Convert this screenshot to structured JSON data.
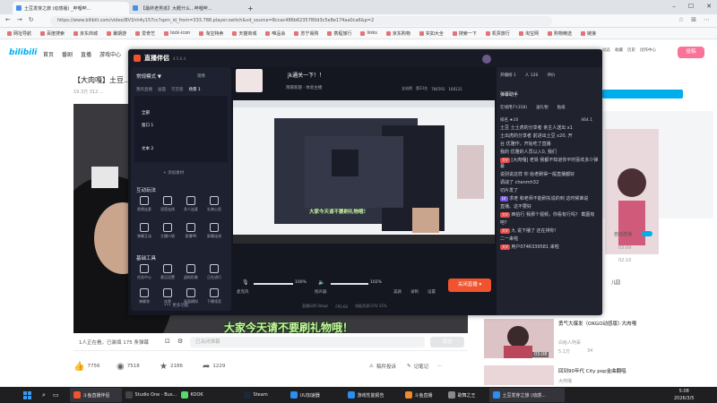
{
  "browser": {
    "tabs": [
      {
        "label": "土豆发芽之旅 (动感版) _哔哩哔..."
      },
      {
        "label": "【最终老男孩】大概什么...哔哩哔..."
      }
    ],
    "new_tab": "+",
    "url": "https://www.bilibili.com/video/BV1hh4y157cc?spm_id_from=333.788.player.switch&vd_source=8ccac486b6235780d3c5e8e174aa0ca6&p=2",
    "bookmarks": [
      "网址导航",
      "百度搜索",
      "京东商城",
      "暑期游",
      "爱奇艺",
      "lock-icon",
      "淘宝特卖",
      "天猫商城",
      "唯品会",
      "苏宁易购",
      "携程旅行",
      "links",
      "京东购物",
      "实如大全",
      "搜索一下",
      "机票旅行",
      "淘宝网",
      "购物精选",
      "链接"
    ]
  },
  "bilibili": {
    "logo": "bilibili",
    "nav": [
      "首页",
      "番剧",
      "直播",
      "游戏中心"
    ],
    "right_nav": [
      "大会员",
      "消息",
      "动态",
      "收藏",
      "历史",
      "创作中心"
    ],
    "upload_btn": "投稿",
    "title": "【大肉嘎】土豆...",
    "meta": "19.3万  312  ...",
    "subtitle": "大家今天请不要刷礼物哦！",
    "watch_count": "1人正在看，已装填 175 条弹幕",
    "danmaku_placeholder": "已关闭弹幕",
    "send": "发送",
    "likes": "7756",
    "coins": "7518",
    "favs": "2186",
    "shares": "1229",
    "report": "稿件投诉",
    "notes": "记笔记",
    "side": {
      "rec1_title": "勇气大爆发（OKGO动感版）·大肉嘎",
      "rec1_author": "白给人阿呆",
      "rec1_views": "5.1万",
      "rec1_danmaku": "34",
      "rec1_duration": "03:08",
      "rec2_title": "回到90年代 City pop金曲翻唱",
      "rec2_author": "大肉嘎",
      "times": [
        "03:09",
        "02:10"
      ],
      "label_auto": "自动连播",
      "child": "儿园"
    }
  },
  "app": {
    "name": "直播伴侣",
    "version": "4.5.6.4",
    "mode": "常规模式 ▼",
    "tabs": [
      "镜像",
      "横屏"
    ],
    "scene_tabs": [
      "我的直播",
      "画面",
      "可见窗",
      "场景 1",
      "+"
    ],
    "sources": [
      "全部",
      "窗口 1",
      "文本 2"
    ],
    "add_source": "+ 添加素材",
    "room_title": "jk通关一下！！",
    "room_sub": "简牒新题 · 体验主播",
    "stats": [
      "全站榜",
      "第23名",
      "784593",
      "168131"
    ],
    "interact_title": "互动玩法",
    "interact": [
      [
        "视频连麦",
        "语音连线",
        "多人连麦",
        "礼物心愿"
      ],
      [
        "弹幕互动",
        "主播口袋",
        "直播PK",
        "屏幕连线"
      ]
    ],
    "tools_title": "基础工具",
    "tools": [
      [
        "任务中心",
        "意见设置",
        "虚拟形象",
        "正在进行"
      ],
      [
        "弹幕答",
        "连登",
        "画面模拟",
        "下播领奖"
      ]
    ],
    "more": "••• 更多功能",
    "preview_overlay": "大家今天请不要刷礼物哦！",
    "preview_caption": "9:16比例直播上面置",
    "mic_label": "麦克风",
    "mic_vol": "100%",
    "spk_label": "扬声器",
    "spk_vol": "102%",
    "status": [
      "直播码率:0kbps",
      "FPS:60",
      "电脑资源:CPU 35%"
    ],
    "ctrl": [
      "美颜",
      "录制",
      "设置"
    ],
    "start": "关闭直播 ▾",
    "right_top": [
      "开播帮助",
      "分享",
      "设置"
    ],
    "right_head": [
      "开播榜 1",
      "人 120",
      "评价"
    ],
    "chat_assistant": "弹幕助手",
    "online_tabs": [
      "在线用户(358)",
      "送礼物",
      "贴纸"
    ],
    "rank": [
      "排名 ★10",
      "464.1"
    ],
    "chat": [
      {
        "name": "土豆",
        "text": "土土虎的分享者 亲主人送出 x1"
      },
      {
        "name": "",
        "text": "土出虎的分享者 前进出土豆 x20, 开"
      },
      {
        "name": "",
        "text": "台 优雅作，开始吃了直播"
      },
      {
        "name": "我的",
        "text": "优雅的人员以入0, 我们"
      },
      {
        "name": "[大肉嘎]",
        "text": "老铁 我都不知道你平时喜欢多少弹幕"
      },
      {
        "name": "",
        "text": "说别说这样 你 给老刷得一般直播都好"
      },
      {
        "name": "",
        "text": "调战了 chenmh32"
      },
      {
        "name": "切片发了",
        "text": ""
      },
      {
        "name": "求老",
        "text": "和老师不能刷东说的到 这时候谁说"
      },
      {
        "name": "",
        "text": "直播。这不要好"
      },
      {
        "name": "西伯行",
        "text": "我那个视频，你看有行吗？ 截图有"
      },
      {
        "name": "",
        "text": "吧?"
      },
      {
        "name": "九",
        "text": "说下播了 还在排你！"
      },
      {
        "name": "",
        "text": "二一来啦"
      },
      {
        "name": "",
        "text": "用户0746339581 来啦"
      }
    ],
    "chat_input": "说点什么吧..."
  },
  "taskbar": {
    "items": [
      "斗鱼直播伴侣",
      "Studio One - Bus...",
      "KOOK",
      "Steam",
      "UU加速器",
      "游戏性能报告",
      "斗鱼直播",
      "歌舞之王",
      "土豆发芽之旅 (动感..."
    ],
    "time": "5:08",
    "date": "2026/3/5"
  },
  "colors": {
    "accent": "#00aeec",
    "start": "#f0532d",
    "app_bg": "#141720"
  }
}
